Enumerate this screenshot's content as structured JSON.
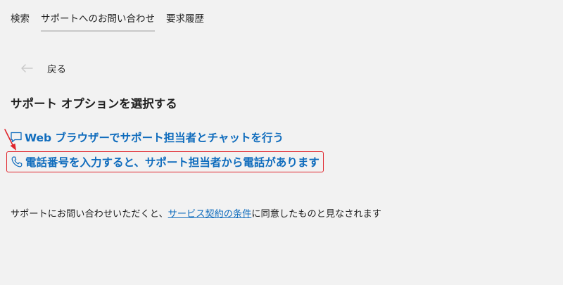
{
  "nav": {
    "tabs": [
      {
        "label": "検索"
      },
      {
        "label": "サポートへのお問い合わせ"
      },
      {
        "label": "要求履歴"
      }
    ]
  },
  "back": {
    "label": "戻る",
    "icon": "arrow-left-icon"
  },
  "heading": "サポート オプションを選択する",
  "options": {
    "chat": {
      "label": "Web ブラウザーでサポート担当者とチャットを行う",
      "icon": "chat-icon"
    },
    "phone": {
      "label": "電話番号を入力すると、サポート担当者から電話があります",
      "icon": "phone-icon"
    }
  },
  "consent": {
    "prefix": "サポートにお問い合わせいただくと、",
    "link": "サービス契約の条件",
    "suffix": "に同意したものと見なされます"
  },
  "colors": {
    "background": "#f2f2f2",
    "link": "#0f6cbd",
    "highlight": "#e0242b"
  }
}
